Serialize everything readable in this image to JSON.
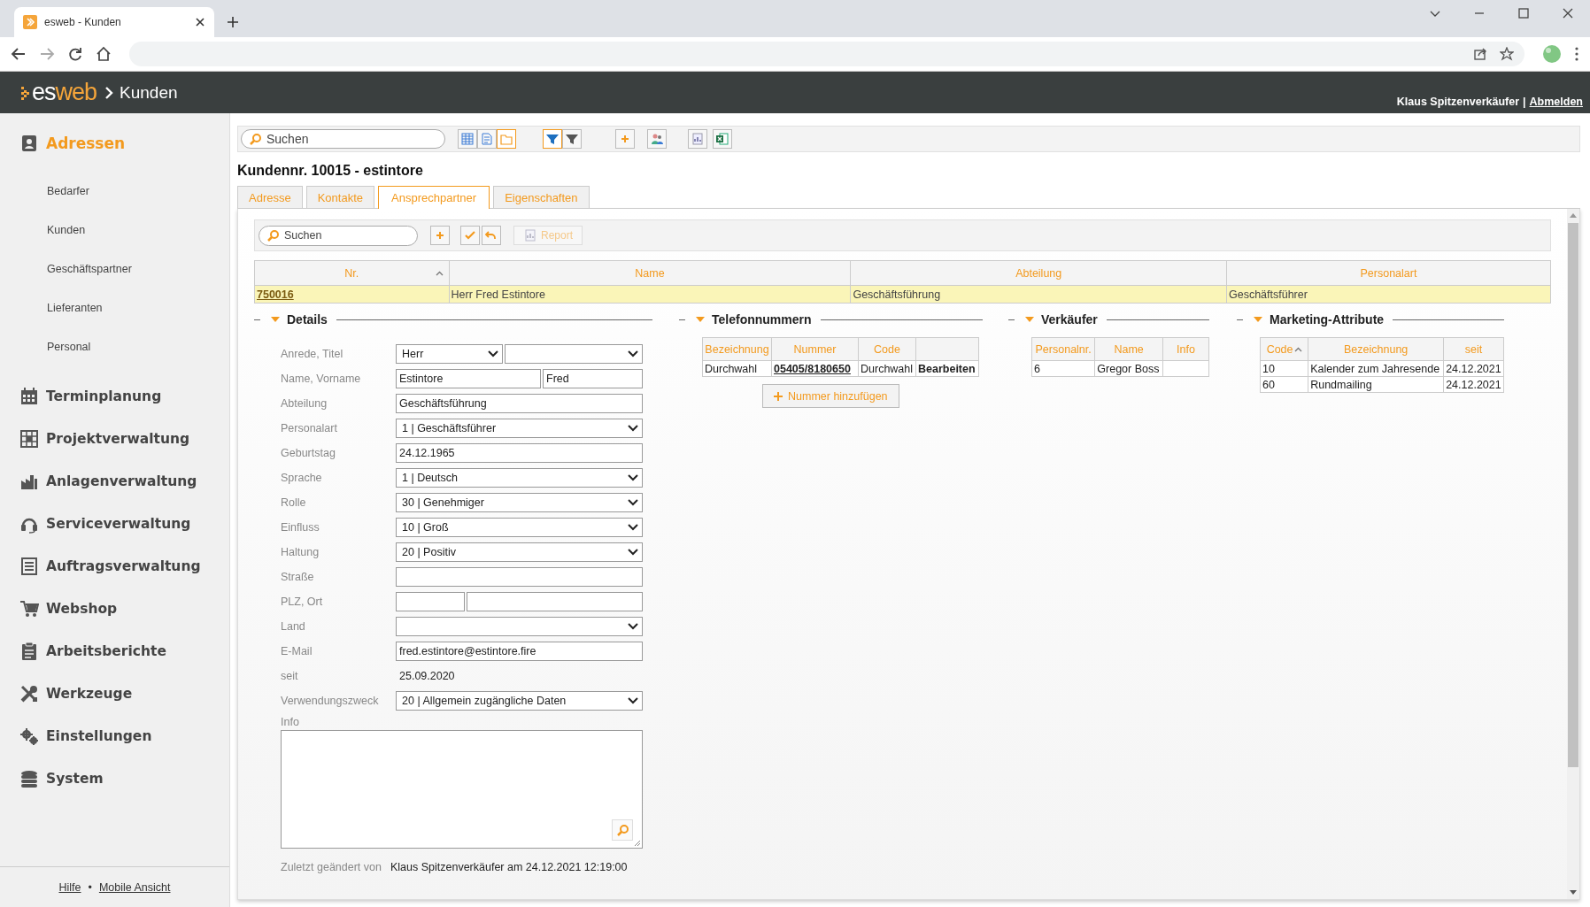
{
  "browser": {
    "tab_title": "esweb - Kunden"
  },
  "app": {
    "logo_parts": [
      "es",
      "web"
    ],
    "breadcrumb": "Kunden",
    "user": "Klaus Spitzenverkäufer",
    "separator": "|",
    "logout": "Abmelden"
  },
  "sidebar": {
    "items": [
      {
        "label": "Adressen",
        "kind": "section",
        "selected": true
      },
      {
        "label": "Bedarfer",
        "kind": "sub",
        "selected": false
      },
      {
        "label": "Kunden",
        "kind": "sub",
        "selected": false
      },
      {
        "label": "Geschäftspartner",
        "kind": "sub",
        "selected": false
      },
      {
        "label": "Lieferanten",
        "kind": "sub",
        "selected": false
      },
      {
        "label": "Personal",
        "kind": "sub",
        "selected": false
      },
      {
        "label": "Terminplanung",
        "kind": "section",
        "selected": false
      },
      {
        "label": "Projektverwaltung",
        "kind": "section",
        "selected": false
      },
      {
        "label": "Anlagenverwaltung",
        "kind": "section",
        "selected": false
      },
      {
        "label": "Serviceverwaltung",
        "kind": "section",
        "selected": false
      },
      {
        "label": "Auftragsverwaltung",
        "kind": "section",
        "selected": false
      },
      {
        "label": "Webshop",
        "kind": "section",
        "selected": false
      },
      {
        "label": "Arbeitsberichte",
        "kind": "section",
        "selected": false
      },
      {
        "label": "Werkzeuge",
        "kind": "section",
        "selected": false
      },
      {
        "label": "Einstellungen",
        "kind": "section",
        "selected": false
      },
      {
        "label": "System",
        "kind": "section",
        "selected": false
      }
    ],
    "footer": {
      "help": "Hilfe",
      "dot": "•",
      "mobile": "Mobile Ansicht"
    }
  },
  "toolbar": {
    "search_placeholder": "Suchen",
    "view_buttons": [
      {
        "selected": false
      },
      {
        "selected": false
      },
      {
        "selected": true
      }
    ],
    "filter_buttons": [
      {
        "selected": true
      },
      {
        "selected": false
      }
    ]
  },
  "title": "Kundennr. 10015 - estintore",
  "tabs": [
    {
      "label": "Adresse",
      "selected": false
    },
    {
      "label": "Kontakte",
      "selected": false
    },
    {
      "label": "Ansprechpartner",
      "selected": true
    },
    {
      "label": "Eigenschaften",
      "selected": false
    }
  ],
  "subtoolbar": {
    "search_placeholder": "Suchen",
    "report": "Report",
    "report_disabled": true
  },
  "table": {
    "columns": [
      {
        "label": "Nr.",
        "sorted": true
      },
      {
        "label": "Name",
        "sorted": false
      },
      {
        "label": "Abteilung",
        "sorted": false
      },
      {
        "label": "Personalart",
        "sorted": false
      }
    ],
    "rows": [
      {
        "cells": [
          "750016",
          "Herr Fred Estintore",
          "Geschäftsführung",
          "Geschäftsführer"
        ],
        "selected": true
      }
    ]
  },
  "details": {
    "title": "Details",
    "expanded": true,
    "fields": [
      {
        "label": "Anrede, Titel",
        "kind": "select_pair",
        "value": "Herr"
      },
      {
        "label": "Name, Vorname",
        "kind": "text_pair",
        "values": [
          "Estintore",
          "Fred"
        ]
      },
      {
        "label": "Abteilung",
        "kind": "text",
        "value": "Geschäftsführung"
      },
      {
        "label": "Personalart",
        "kind": "select",
        "value": "1 | Geschäftsführer"
      },
      {
        "label": "Geburtstag",
        "kind": "text",
        "value": "24.12.1965"
      },
      {
        "label": "Sprache",
        "kind": "select",
        "value": "1 | Deutsch"
      },
      {
        "label": "Rolle",
        "kind": "select",
        "value": "30 | Genehmiger"
      },
      {
        "label": "Einfluss",
        "kind": "select",
        "value": "10 | Groß"
      },
      {
        "label": "Haltung",
        "kind": "select",
        "value": "20 | Positiv"
      },
      {
        "label": "Straße",
        "kind": "text"
      },
      {
        "label": "PLZ, Ort",
        "kind": "text_split"
      },
      {
        "label": "Land",
        "kind": "select"
      },
      {
        "label": "E-Mail",
        "kind": "text",
        "value": "fred.estintore@estintore.fire"
      },
      {
        "label": "seit",
        "kind": "plain",
        "value": "25.09.2020"
      },
      {
        "label": "Verwendungszweck",
        "kind": "select",
        "value": "20 | Allgemein zugängliche Daten"
      },
      {
        "label": "Info",
        "kind": "textarea"
      }
    ],
    "changed_label": "Zuletzt geändert von",
    "changed_value": "Klaus Spitzenverkäufer am 24.12.2021 12:19:00"
  },
  "phones": {
    "title": "Telefonnummern",
    "expanded": true,
    "columns": [
      "Bezeichnung",
      "Nummer",
      "Code"
    ],
    "rows": [
      {
        "cells": [
          {
            "text": "Durchwahl",
            "kind": "text"
          },
          {
            "text": "05405/8180650",
            "kind": "link"
          },
          {
            "text": "Durchwahl",
            "kind": "text"
          },
          {
            "text": "Bearbeiten",
            "kind": "action"
          }
        ]
      }
    ],
    "add_button": "Nummer hinzufügen"
  },
  "sellers": {
    "title": "Verkäufer",
    "expanded": true,
    "columns": [
      {
        "label": "Personalnr.",
        "sorted": false
      },
      {
        "label": "Name",
        "sorted": false
      },
      {
        "label": "Info",
        "sorted": false
      }
    ],
    "rows": [
      {
        "cells": [
          "6",
          "Gregor Boss"
        ]
      }
    ]
  },
  "marketing": {
    "title": "Marketing-Attribute",
    "expanded": true,
    "columns": [
      {
        "label": "Code",
        "sorted": true
      },
      {
        "label": "Bezeichnung",
        "sorted": false
      },
      {
        "label": "seit",
        "sorted": false
      }
    ],
    "rows": [
      {
        "cells": [
          "10",
          "Kalender zum Jahresende",
          "24.12.2021"
        ]
      },
      {
        "cells": [
          "60",
          "Rundmailing",
          "24.12.2021"
        ]
      }
    ]
  }
}
